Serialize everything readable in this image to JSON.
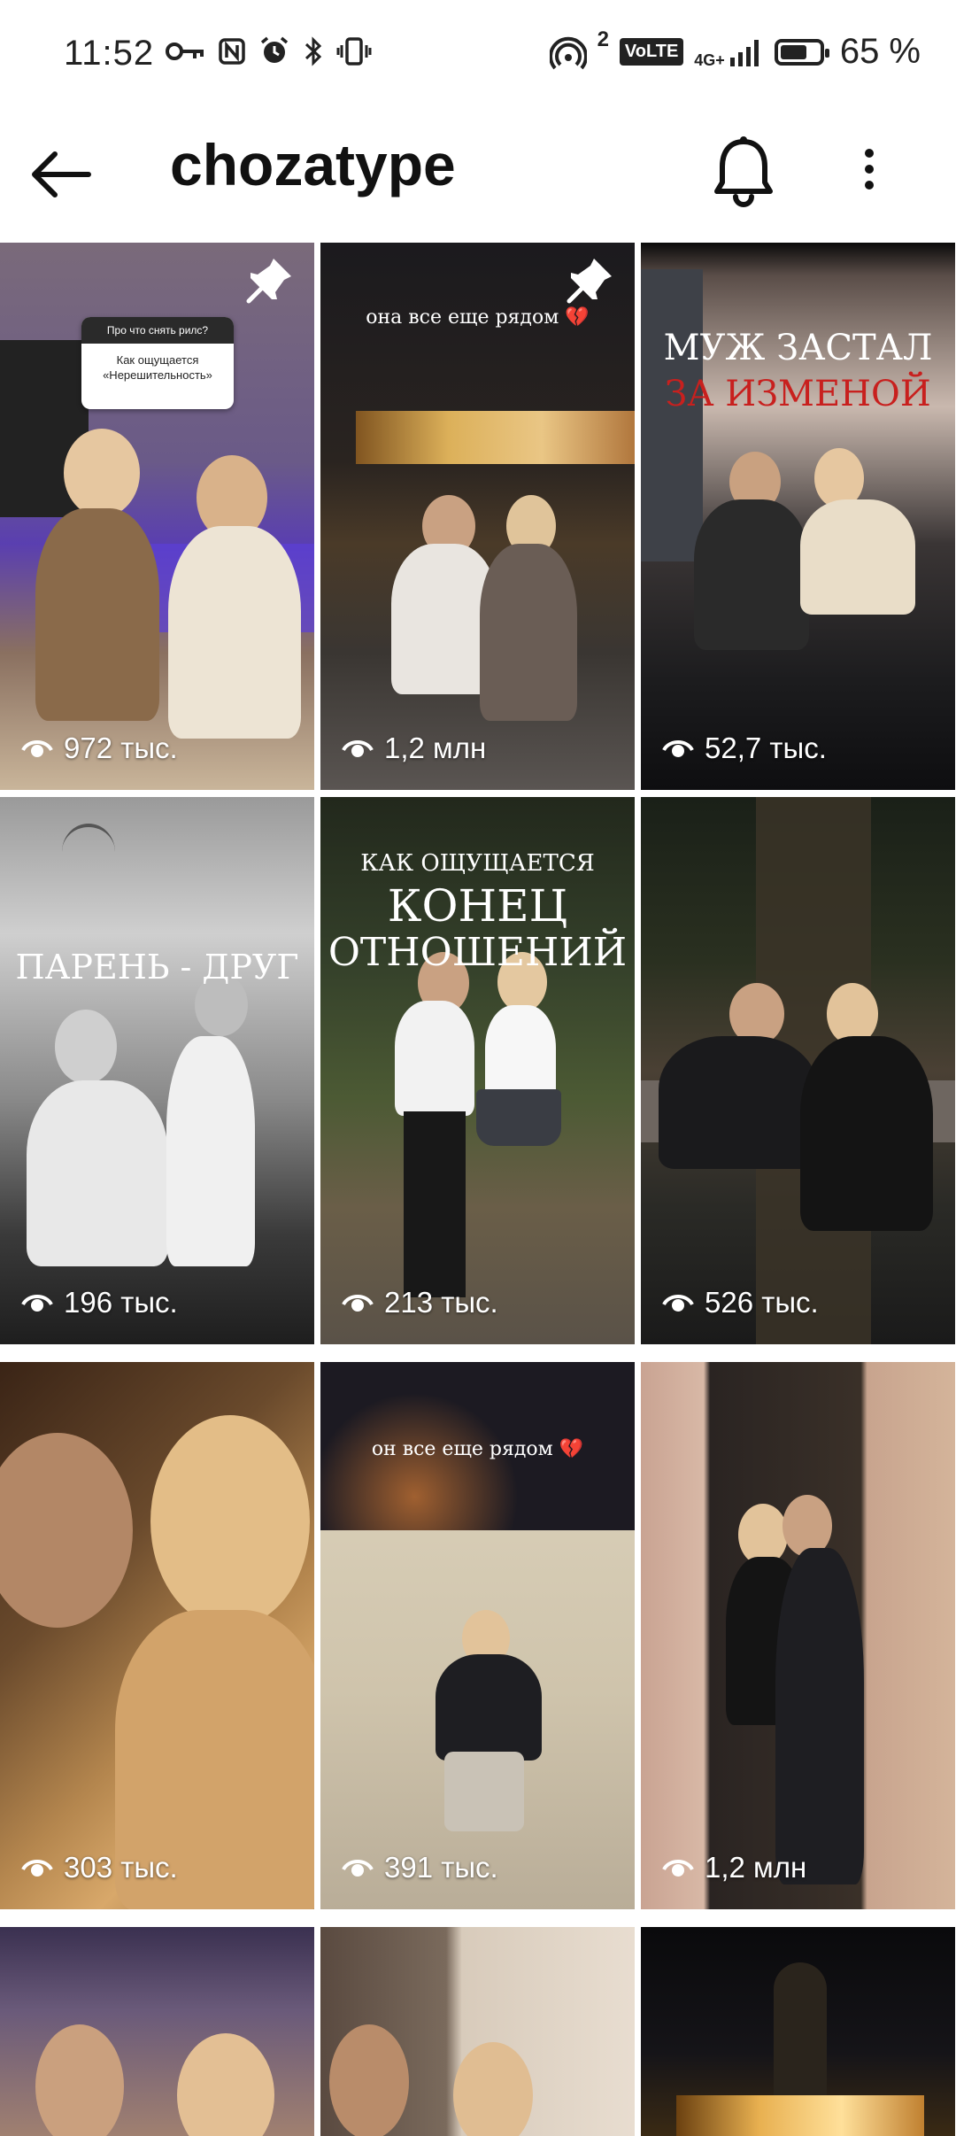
{
  "status_bar": {
    "time": "11:52",
    "signal_sup": "2",
    "volte": "VoLTE",
    "network": "4G+",
    "battery": "65 %"
  },
  "header": {
    "title": "chozatype"
  },
  "icons": {
    "back": "arrow-left-icon",
    "bell": "bell-icon",
    "more": "more-vertical-icon",
    "views": "eye-icon",
    "pin": "pin-icon"
  },
  "reels": [
    {
      "views": "972 тыс.",
      "pinned": true,
      "question_title": "Про что снять рилс?",
      "question_text": "Как ощущается «Нерешительность»"
    },
    {
      "views": "1,2 млн",
      "pinned": true,
      "caption": "она все еще рядом 💔"
    },
    {
      "views": "52,7 тыс.",
      "caption_line1": "МУЖ ЗАСТАЛ",
      "caption_line2": "ЗА ИЗМЕНОЙ"
    },
    {
      "views": "196 тыс.",
      "caption": "ПАРЕНЬ - ДРУГ"
    },
    {
      "views": "213 тыс.",
      "caption_line1": "КАК ОЩУЩАЕТСЯ",
      "caption_line2": "КОНЕЦ",
      "caption_line3": "ОТНОШЕНИЙ"
    },
    {
      "views": "526 тыс."
    },
    {
      "views": "303 тыс."
    },
    {
      "views": "391 тыс.",
      "caption": "он все еще рядом 💔"
    },
    {
      "views": "1,2 млн"
    },
    {},
    {},
    {}
  ]
}
